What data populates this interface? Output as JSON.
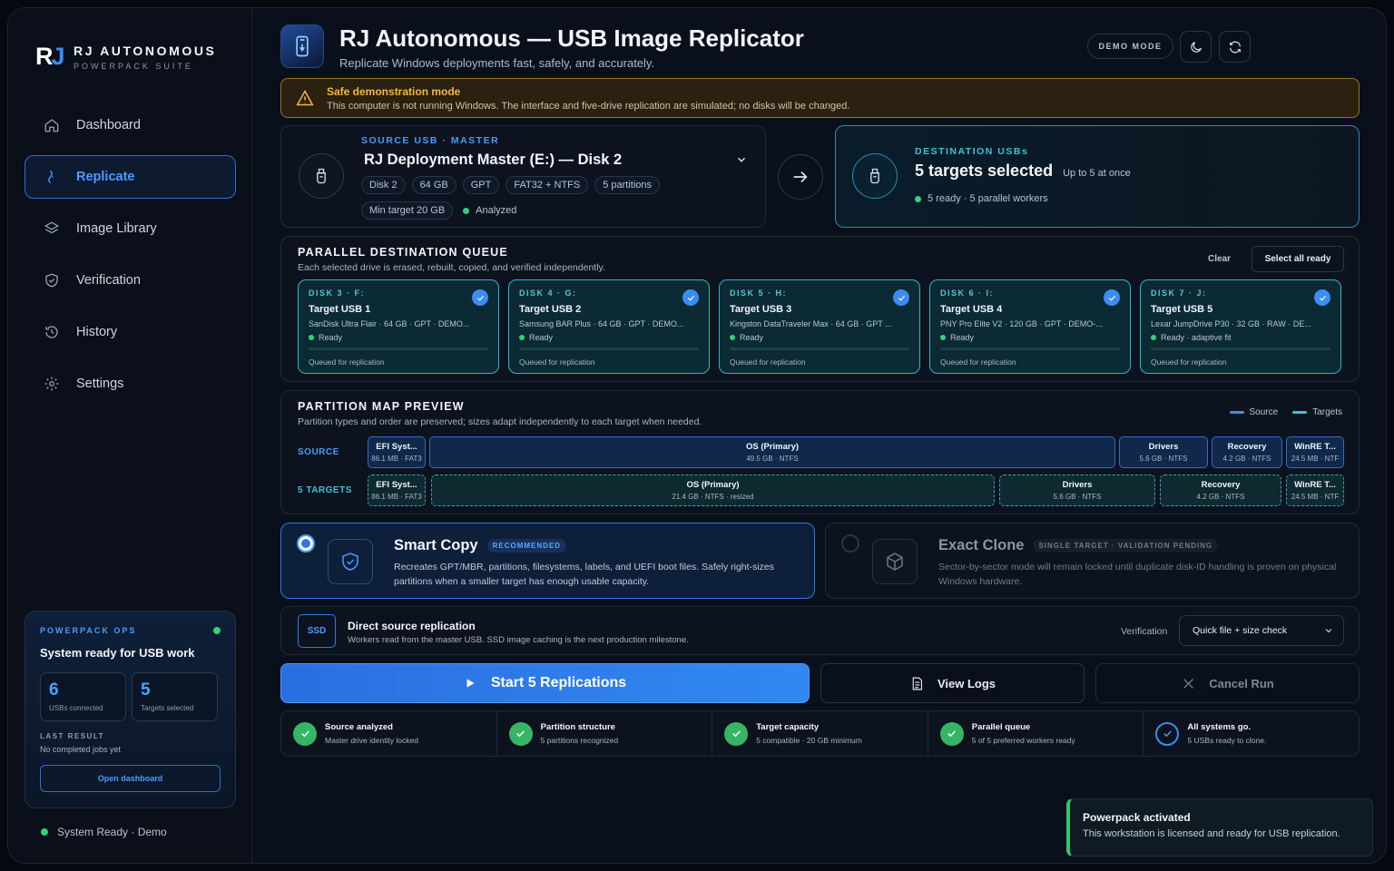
{
  "brand": {
    "mark_r": "R",
    "mark_j": "J",
    "title": "RJ AUTONOMOUS",
    "subtitle": "POWERPACK SUITE"
  },
  "nav": [
    {
      "label": "Dashboard",
      "icon": "home-icon"
    },
    {
      "label": "Replicate",
      "icon": "usb-plug-icon",
      "active": true
    },
    {
      "label": "Image Library",
      "icon": "layers-icon"
    },
    {
      "label": "Verification",
      "icon": "shield-check-icon"
    },
    {
      "label": "History",
      "icon": "history-icon"
    },
    {
      "label": "Settings",
      "icon": "gear-icon"
    }
  ],
  "ops": {
    "heading": "POWERPACK OPS",
    "title": "System ready for USB work",
    "stats": [
      {
        "value": "6",
        "label": "USBs connected"
      },
      {
        "value": "5",
        "label": "Targets selected"
      }
    ],
    "last_result_label": "LAST RESULT",
    "last_result": "No completed jobs yet",
    "button": "Open dashboard"
  },
  "system_status": "System Ready · Demo",
  "header": {
    "title": "RJ Autonomous — USB Image Replicator",
    "subtitle": "Replicate Windows deployments fast, safely, and accurately.",
    "demo_pill": "DEMO MODE"
  },
  "warning": {
    "title": "Safe demonstration mode",
    "text": "This computer is not running Windows. The interface and five-drive replication are simulated; no disks will be changed."
  },
  "source": {
    "label": "SOURCE USB · MASTER",
    "name": "RJ Deployment Master (E:) — Disk 2",
    "chips": [
      "Disk 2",
      "64 GB",
      "GPT",
      "FAT32 + NTFS",
      "5 partitions"
    ],
    "min_target": "Min target 20 GB",
    "analyzed": "Analyzed"
  },
  "destination": {
    "label": "DESTINATION USBs",
    "title": "5 targets selected",
    "note": "Up to 5 at once",
    "status": "5 ready · 5 parallel workers"
  },
  "queue": {
    "title": "PARALLEL DESTINATION QUEUE",
    "subtitle": "Each selected drive is erased, rebuilt, copied, and verified independently.",
    "clear": "Clear",
    "select_all": "Select all ready",
    "targets": [
      {
        "disk": "DISK 3 · F:",
        "name": "Target USB 1",
        "info": "SanDisk Ultra Flair · 64 GB · GPT · DEMO...",
        "status": "Ready",
        "queue": "Queued for replication"
      },
      {
        "disk": "DISK 4 · G:",
        "name": "Target USB 2",
        "info": "Samsung BAR Plus · 64 GB · GPT · DEMO...",
        "status": "Ready",
        "queue": "Queued for replication"
      },
      {
        "disk": "DISK 5 · H:",
        "name": "Target USB 3",
        "info": "Kingston DataTraveler Max · 64 GB · GPT ...",
        "status": "Ready",
        "queue": "Queued for replication"
      },
      {
        "disk": "DISK 6 · I:",
        "name": "Target USB 4",
        "info": "PNY Pro Elite V2 · 120 GB · GPT · DEMO-...",
        "status": "Ready",
        "queue": "Queued for replication"
      },
      {
        "disk": "DISK 7 · J:",
        "name": "Target USB 5",
        "info": "Lexar JumpDrive P30 · 32 GB · RAW · DE...",
        "status": "Ready · adaptive fit",
        "queue": "Queued for replication"
      }
    ]
  },
  "partition_map": {
    "title": "PARTITION MAP PREVIEW",
    "subtitle": "Partition types and order are preserved; sizes adapt independently to each target when needed.",
    "legend_source": "Source",
    "legend_targets": "Targets",
    "colors": {
      "source": "#3b8df0",
      "targets": "#3fc1d6"
    },
    "source_label": "SOURCE",
    "targets_label": "5 TARGETS",
    "source_parts": [
      {
        "name": "EFI Syst...",
        "size": "86.1 MB · FAT3"
      },
      {
        "name": "OS (Primary)",
        "size": "49.5 GB · NTFS"
      },
      {
        "name": "Drivers",
        "size": "5.6 GB · NTFS"
      },
      {
        "name": "Recovery",
        "size": "4.2 GB · NTFS"
      },
      {
        "name": "WinRE T...",
        "size": "24.5 MB · NTF"
      }
    ],
    "target_parts": [
      {
        "name": "EFI Syst...",
        "size": "86.1 MB · FAT3"
      },
      {
        "name": "OS (Primary)",
        "size": "21.4 GB · NTFS · resized"
      },
      {
        "name": "Drivers",
        "size": "5.6 GB · NTFS"
      },
      {
        "name": "Recovery",
        "size": "4.2 GB · NTFS"
      },
      {
        "name": "WinRE T...",
        "size": "24.5 MB · NTF"
      }
    ]
  },
  "modes": {
    "smart": {
      "title": "Smart Copy",
      "tag": "RECOMMENDED",
      "desc": "Recreates GPT/MBR, partitions, filesystems, labels, and UEFI boot files. Safely right-sizes partitions when a smaller target has enough usable capacity.",
      "selected": true
    },
    "exact": {
      "title": "Exact Clone",
      "tag": "SINGLE TARGET · VALIDATION PENDING",
      "desc": "Sector-by-sector mode will remain locked until duplicate disk-ID handling is proven on physical Windows hardware.",
      "selected": false
    }
  },
  "direct": {
    "badge": "SSD",
    "title": "Direct source replication",
    "subtitle": "Workers read from the master USB. SSD image caching is the next production milestone.",
    "verification_label": "Verification",
    "verification_value": "Quick file + size check"
  },
  "actions": {
    "start": "Start 5 Replications",
    "logs": "View Logs",
    "cancel": "Cancel Run"
  },
  "checks": [
    {
      "title": "Source analyzed",
      "sub": "Master drive identity locked"
    },
    {
      "title": "Partition structure",
      "sub": "5 partitions recognized"
    },
    {
      "title": "Target capacity",
      "sub": "5 compatible · 20 GB minimum"
    },
    {
      "title": "Parallel queue",
      "sub": "5 of 5 preferred workers ready"
    },
    {
      "title": "All systems go.",
      "sub": "5 USBs ready to clone."
    }
  ],
  "toast": {
    "title": "Powerpack activated",
    "text": "This workstation is licensed and ready for USB replication."
  }
}
